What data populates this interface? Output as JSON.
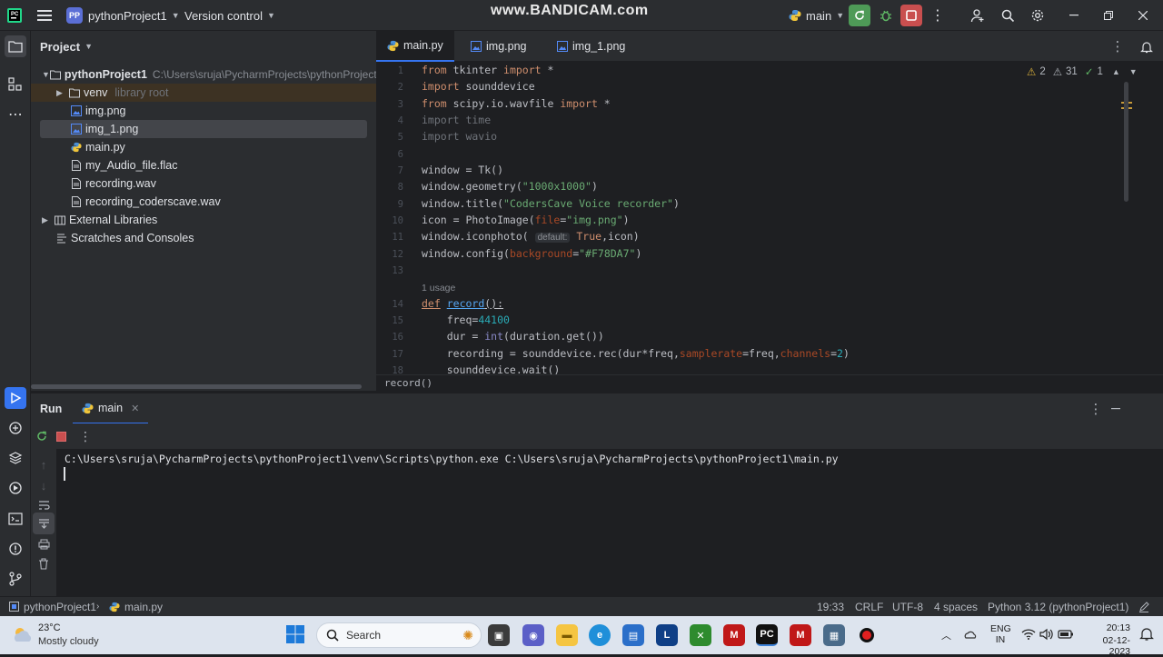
{
  "titlebar": {
    "project_badge": "PP",
    "project_name": "pythonProject1",
    "vcs_label": "Version control",
    "run_config": "main",
    "watermark": "www.BANDICAM.com"
  },
  "project_panel": {
    "title": "Project",
    "tree": [
      {
        "name": "pythonProject1",
        "hint": "C:\\Users\\sruja\\PycharmProjects\\pythonProject1"
      },
      {
        "name": "venv",
        "hint": "library root"
      },
      {
        "name": "img.png"
      },
      {
        "name": "img_1.png"
      },
      {
        "name": "main.py"
      },
      {
        "name": "my_Audio_file.flac"
      },
      {
        "name": "recording.wav"
      },
      {
        "name": "recording_coderscave.wav"
      },
      {
        "name": "External Libraries"
      },
      {
        "name": "Scratches and Consoles"
      }
    ]
  },
  "editor": {
    "tabs": [
      {
        "label": "main.py"
      },
      {
        "label": "img.png"
      },
      {
        "label": "img_1.png"
      }
    ],
    "inspections": {
      "warnings": "2",
      "weak_warnings": "31",
      "ok": "1"
    },
    "usage_hint": "1 usage",
    "param_hint": "default:",
    "breadcrumb": "record()",
    "line_numbers": [
      "1",
      "2",
      "3",
      "4",
      "5",
      "6",
      "7",
      "8",
      "9",
      "10",
      "11",
      "12",
      "13",
      "14",
      "15",
      "16",
      "17",
      "18"
    ]
  },
  "run_panel": {
    "title": "Run",
    "tab_label": "main",
    "console_line": "C:\\Users\\sruja\\PycharmProjects\\pythonProject1\\venv\\Scripts\\python.exe C:\\Users\\sruja\\PycharmProjects\\pythonProject1\\main.py"
  },
  "statusbar": {
    "crumb_project": "pythonProject1",
    "crumb_file": "main.py",
    "position": "19:33",
    "line_sep": "CRLF",
    "encoding": "UTF-8",
    "indent": "4 spaces",
    "interpreter": "Python 3.12 (pythonProject1)"
  },
  "taskbar": {
    "weather_temp": "23°C",
    "weather_desc": "Mostly cloudy",
    "search_placeholder": "Search",
    "lang_line1": "ENG",
    "lang_line2": "IN",
    "time": "20:13",
    "date": "02-12-2023"
  },
  "colors": {
    "editor_bg": "#1e1f22",
    "panel_bg": "#2b2d30",
    "keyword": "#cf8e6d",
    "string": "#6aab73",
    "number": "#2aacb8",
    "run_green": "#4e9a57",
    "stop_red": "#c94f4f"
  }
}
